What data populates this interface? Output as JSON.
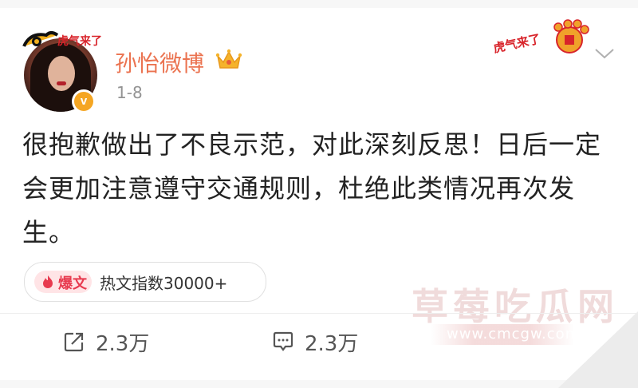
{
  "post": {
    "username": "孙怡微博",
    "time": "1-8",
    "text": "很抱歉做出了不良示范，对此深刻反思！日后一定会更加注意遵守交通规则，杜绝此类情况再次发生。",
    "avatar_frame_text": "虎气来了",
    "deco_text": "虎气来了"
  },
  "hot": {
    "badge_label": "爆文",
    "index_text": "热文指数30000+"
  },
  "actions": {
    "repost_count": "2.3万",
    "comment_count": "2.3万"
  },
  "watermark": {
    "title": "草莓吃瓜网",
    "url": "www.cmcgw.com"
  },
  "colors": {
    "username": "#eb7350",
    "hot_badge": "#e83a4f",
    "verified": "#f5a623"
  }
}
